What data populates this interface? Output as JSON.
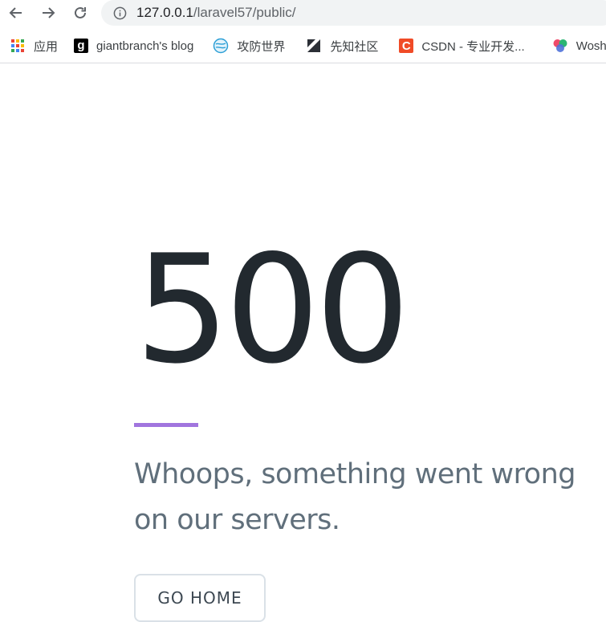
{
  "browser": {
    "back_icon": "arrow-left-icon",
    "forward_icon": "arrow-right-icon",
    "reload_icon": "reload-icon",
    "site_info_icon": "info-circle-icon",
    "url_host": "127.0.0.1",
    "url_path": "/laravel57/public/"
  },
  "bookmarks": [
    {
      "label": "应用",
      "icon": "apps-grid-icon"
    },
    {
      "label": "giantbranch's blog",
      "icon": "g-logo-icon",
      "icon_text": "g"
    },
    {
      "label": "攻防世界",
      "icon": "globe-icon"
    },
    {
      "label": "先知社区",
      "icon": "xianzhi-logo-icon"
    },
    {
      "label": "CSDN - 专业开发...",
      "icon": "csdn-logo-icon",
      "icon_text": "C"
    },
    {
      "label": "Wosh",
      "icon": "colorful-dots-icon"
    }
  ],
  "error": {
    "code": "500",
    "message": "Whoops, something went wrong on our servers.",
    "button_label": "GO HOME",
    "accent_color": "#a175de"
  }
}
